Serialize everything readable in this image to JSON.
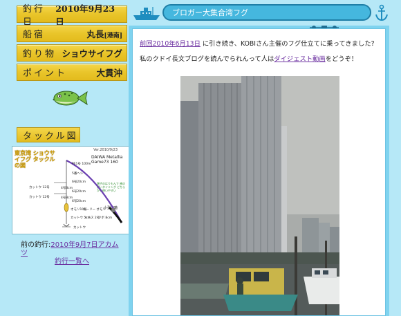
{
  "info_plates": [
    {
      "label": "釣行日",
      "value": "2010年9月23日"
    },
    {
      "label": "船宿",
      "value": "丸長",
      "value_suffix": "[港南]"
    },
    {
      "label": "釣り物",
      "value": "ショウサイフグ"
    },
    {
      "label": "ポイント",
      "value": "大貫沖"
    }
  ],
  "tackle": {
    "heading": "タックル図",
    "title": "東京湾 ショウサイフグ タックルの図",
    "version": "Ver.2010/9/23",
    "rod": "DAIWA Metallia Game73 160",
    "note": "潮子のはりもんで 感の遅いタイミング どちらかを使いやすい",
    "reel": "小型両軸",
    "labels": [
      "PE1号 100m",
      "5番ヘシ",
      "6号20cm",
      "4号8cm",
      "6号20cm",
      "4号8cm",
      "6号20cm",
      "カットウ 12号",
      "カットウ 12号",
      "オモリ10号",
      "ホーリー オモリ",
      "カットウ 5cm",
      "ハリス 2号",
      "ツボ 8cm",
      "カットウ"
    ]
  },
  "prev_trip": {
    "prefix": "前の釣行:",
    "link": "2010年9月7日アカムツ",
    "list_link": "釣行一覧へ"
  },
  "header": {
    "title": "ブロガー大集合湾フグ"
  },
  "post": {
    "link1": "前回2010年6月13日",
    "text1": "に引き続き、KOBIさん主催のフグ仕立てに乗ってきました?",
    "text2_pre": "私のクドイ長文ブログを読んでられんって人は",
    "link2": "ダイジェスト動画",
    "text2_post": "をどうぞ！"
  },
  "colors": {
    "page_bg": "#b6e8f7",
    "plate": "#e9c52a",
    "header_bar": "#45b7de",
    "link": "#6b2fa0"
  }
}
